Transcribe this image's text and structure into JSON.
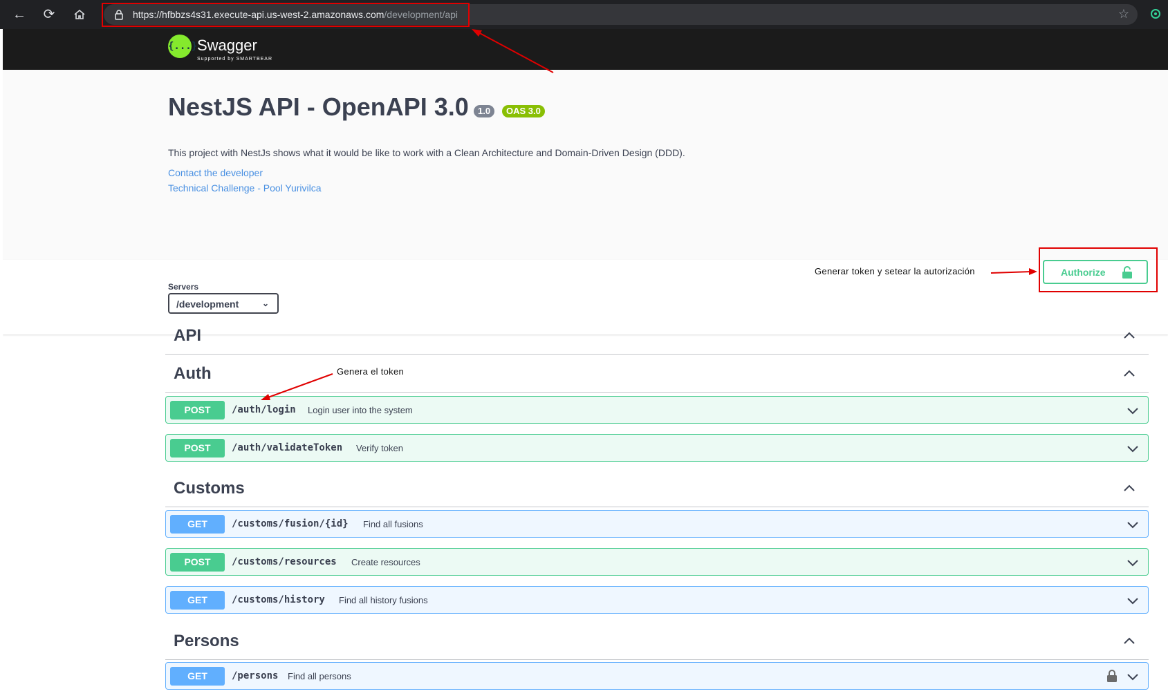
{
  "browser": {
    "url_host": "https://hfbbzs4s31.execute-api.us-west-2.amazonaws.com",
    "url_path": "/development/api"
  },
  "swagger": {
    "logo_text": "Swagger",
    "logo_sub": "Supported by SMARTBEAR",
    "logo_glyph": "{...}"
  },
  "info": {
    "title": "NestJS API - OpenAPI 3.0",
    "version": "1.0",
    "oas": "OAS 3.0",
    "description": "This project with NestJs shows what it would be like to work with a Clean Architecture and Domain-Driven Design (DDD).",
    "links": [
      "Contact the developer",
      "Technical Challenge - Pool Yurivilca"
    ]
  },
  "servers": {
    "label": "Servers",
    "selected": "/development"
  },
  "authorize": {
    "label": "Authorize"
  },
  "annotations": {
    "authorize_note": "Generar token y setear la autorización",
    "login_note": "Genera el token"
  },
  "tags": [
    {
      "name": "API"
    },
    {
      "name": "Auth"
    },
    {
      "name": "Customs"
    },
    {
      "name": "Persons"
    }
  ],
  "operations": [
    {
      "method": "POST",
      "path": "/auth/login",
      "summary": "Login user into the system"
    },
    {
      "method": "POST",
      "path": "/auth/validateToken",
      "summary": "Verify token"
    },
    {
      "method": "GET",
      "path": "/customs/fusion/{id}",
      "summary": "Find all fusions"
    },
    {
      "method": "POST",
      "path": "/customs/resources",
      "summary": "Create resources"
    },
    {
      "method": "GET",
      "path": "/customs/history",
      "summary": "Find all history fusions"
    },
    {
      "method": "GET",
      "path": "/persons",
      "summary": "Find all persons"
    }
  ],
  "colors": {
    "post": "#49cc90",
    "get": "#61affe",
    "annotation_red": "#e00000"
  }
}
